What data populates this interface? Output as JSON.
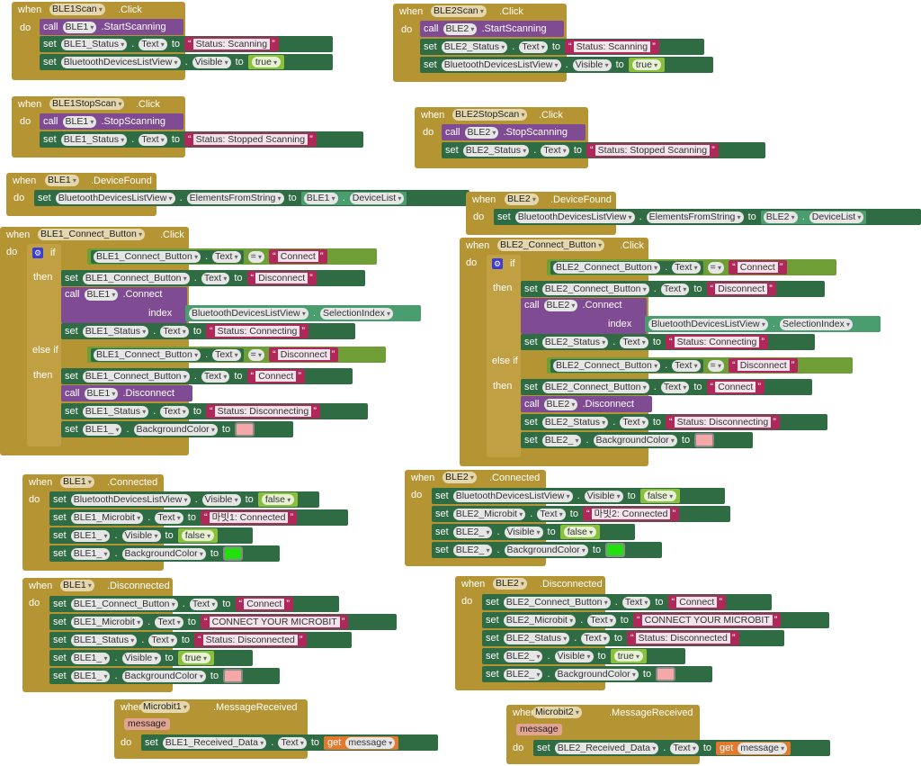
{
  "kw": {
    "when": "when",
    "do": "do",
    "call": "call",
    "set": "set",
    "to": "to",
    "if": "if",
    "then": "then",
    "elseif": "else if",
    "index": "index",
    "get": "get",
    "dot": "."
  },
  "props": {
    "text": "Text",
    "visible": "Visible",
    "bg": "BackgroundColor",
    "elements_from_string": "ElementsFromString",
    "device_list": "DeviceList",
    "selection_index": "SelectionIndex"
  },
  "bools": {
    "t": "true",
    "f": "false"
  },
  "blocks": {
    "b1": {
      "comp": "BLE1Scan",
      "event": ".Click",
      "c1": "BLE1",
      "m1": ".StartScanning",
      "s1": "BLE1_Status",
      "v1": "Status: Scanning",
      "s2": "BluetoothDevicesListView"
    },
    "b2": {
      "comp": "BLE2Scan",
      "event": ".Click",
      "c1": "BLE2",
      "m1": ".StartScanning",
      "s1": "BLE2_Status",
      "v1": "Status: Scanning",
      "s2": "BluetoothDevicesListView"
    },
    "b3": {
      "comp": "BLE1StopScan",
      "event": ".Click",
      "c1": "BLE1",
      "m1": ".StopScanning",
      "s1": "BLE1_Status",
      "v1": "Status: Stopped Scanning"
    },
    "b4": {
      "comp": "BLE2StopScan",
      "event": ".Click",
      "c1": "BLE2",
      "m1": ".StopScanning",
      "s1": "BLE2_Status",
      "v1": "Status: Stopped Scanning"
    },
    "b5": {
      "comp": "BLE1",
      "event": ".DeviceFound",
      "s1": "BluetoothDevicesListView",
      "c1": "BLE1"
    },
    "b6": {
      "comp": "BLE2",
      "event": ".DeviceFound",
      "s1": "BluetoothDevicesListView",
      "c1": "BLE2"
    },
    "b7": {
      "comp": "BLE1_Connect_Button",
      "event": ".Click",
      "btn": "BLE1_Connect_Button",
      "ble": "BLE1",
      "connect": "Connect",
      "disconnect": "Disconnect",
      "m_connect": ".Connect",
      "m_disconnect": ".Disconnect",
      "list": "BluetoothDevicesListView",
      "status": "BLE1_Status",
      "connecting": "Status: Connecting",
      "disconnecting": "Status: Disconnecting",
      "bgcomp": "BLE1_"
    },
    "b8": {
      "comp": "BLE2_Connect_Button",
      "event": ".Click",
      "btn": "BLE2_Connect_Button",
      "ble": "BLE2",
      "connect": "Connect",
      "disconnect": "Disconnect",
      "m_connect": ".Connect",
      "m_disconnect": ".Disconnect",
      "list": "BluetoothDevicesListView",
      "status": "BLE2_Status",
      "connecting": "Status: Connecting",
      "disconnecting": "Status: Disconnecting",
      "bgcomp": "BLE2_"
    },
    "b9": {
      "comp": "BLE1",
      "event": ".Connected",
      "list": "BluetoothDevicesListView",
      "mb": "BLE1_Microbit",
      "mbtext": "마빗1: Connected",
      "bgcomp": "BLE1_"
    },
    "b10": {
      "comp": "BLE2",
      "event": ".Connected",
      "list": "BluetoothDevicesListView",
      "mb": "BLE2_Microbit",
      "mbtext": "마빗2: Connected",
      "bgcomp": "BLE2_"
    },
    "b11": {
      "comp": "BLE1",
      "event": ".Disconnected",
      "btn": "BLE1_Connect_Button",
      "connect": "Connect",
      "mb": "BLE1_Microbit",
      "mbtext": "CONNECT YOUR MICROBIT",
      "status": "BLE1_Status",
      "stext": "Status: Disconnected",
      "bgcomp": "BLE1_"
    },
    "b12": {
      "comp": "BLE2",
      "event": ".Disconnected",
      "btn": "BLE2_Connect_Button",
      "connect": "Connect",
      "mb": "BLE2_Microbit",
      "mbtext": "CONNECT YOUR MICROBIT",
      "status": "BLE2_Status",
      "stext": "Status: Disconnected",
      "bgcomp": "BLE2_"
    },
    "b13": {
      "comp": "Microbit1",
      "event": ".MessageReceived",
      "param": "message",
      "target": "BLE1_Received_Data",
      "getv": "message"
    },
    "b14": {
      "comp": "Microbit2",
      "event": ".MessageReceived",
      "param": "message",
      "target": "BLE2_Received_Data",
      "getv": "message"
    }
  },
  "colors": {
    "event": "#b59433",
    "set": "#2f6b43",
    "call": "#7f4b93",
    "text": "#b0285a",
    "logic": "#8bbf3a",
    "pink_swatch": "#f4a9a8",
    "green_swatch": "#22e00e"
  }
}
